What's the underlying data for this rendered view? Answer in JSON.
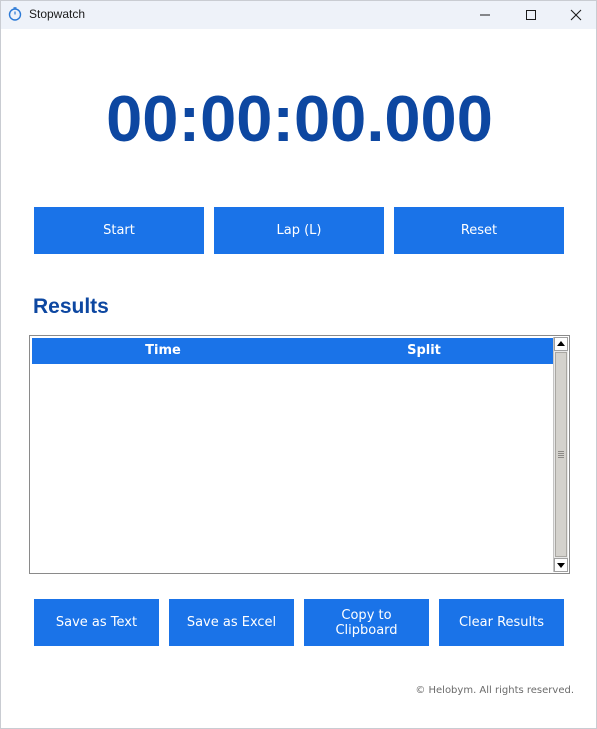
{
  "window": {
    "title": "Stopwatch",
    "icon": "stopwatch-icon",
    "controls": [
      "minimize-icon",
      "maximize-icon",
      "close-icon"
    ]
  },
  "timer": {
    "display": "00:00:00.000"
  },
  "controls": {
    "start_label": "Start",
    "lap_label": "Lap (L)",
    "reset_label": "Reset"
  },
  "results": {
    "heading": "Results",
    "columns": [
      "Time",
      "Split"
    ],
    "rows": []
  },
  "actions": {
    "save_text_label": "Save as Text",
    "save_excel_label": "Save as Excel",
    "copy_label": "Copy to Clipboard",
    "clear_label": "Clear Results"
  },
  "footer": {
    "copyright": "© Helobym. All rights reserved."
  },
  "colors": {
    "accent": "#1a73e8",
    "heading": "#0d47a1",
    "titlebar": "#eef2f9"
  }
}
